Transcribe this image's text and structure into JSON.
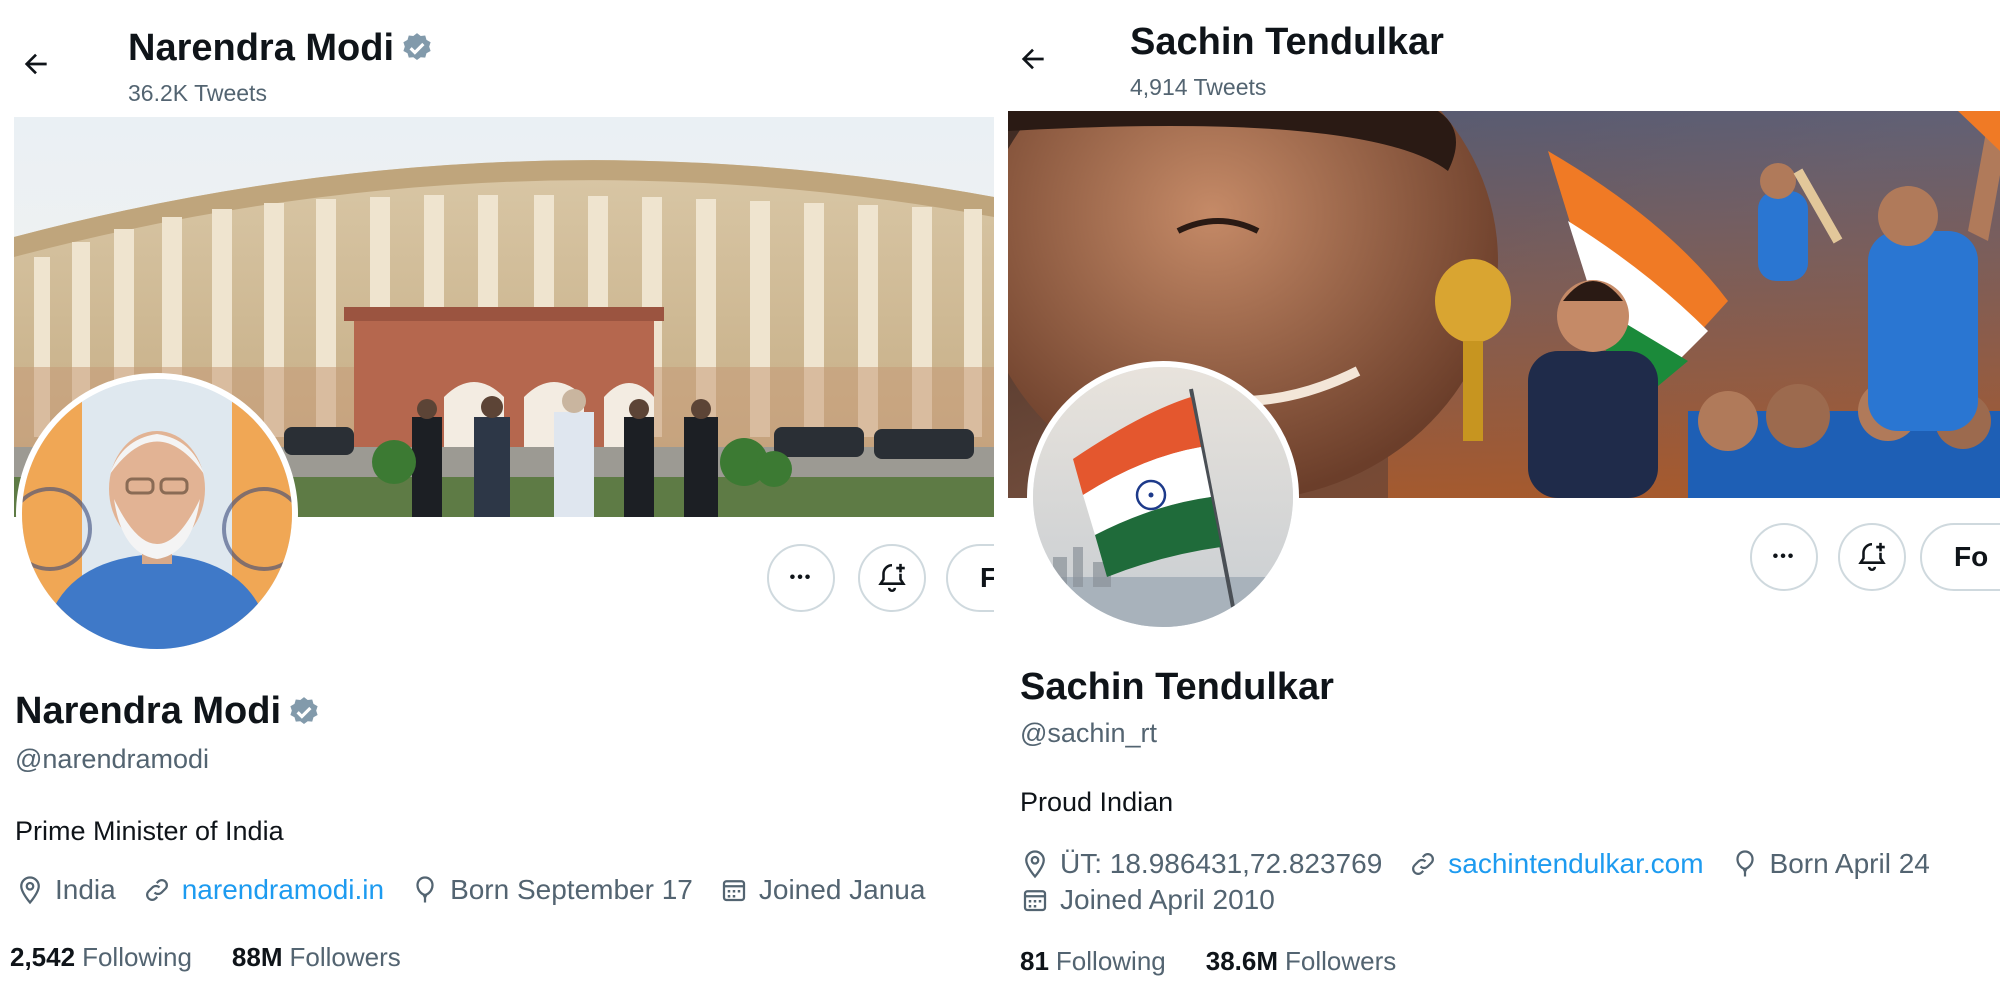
{
  "profiles": [
    {
      "header_name": "Narendra Modi",
      "header_tweets": "36.2K Tweets",
      "name": "Narendra Modi",
      "handle": "@narendramodi",
      "bio": "Prime Minister of India",
      "location": "India",
      "website": "narendramodi.in",
      "born": "Born September 17",
      "joined": "Joined Janua",
      "following_count": "2,542",
      "following_label": "Following",
      "followers_count": "88M",
      "followers_label": "Followers",
      "more_label": "•••",
      "follow_label": "F",
      "verified": true
    },
    {
      "header_name": "Sachin Tendulkar",
      "header_tweets": "4,914 Tweets",
      "name": "Sachin Tendulkar",
      "handle": "@sachin_rt",
      "bio": "Proud Indian",
      "location": "ÜT: 18.986431,72.823769",
      "website": "sachintendulkar.com",
      "born": "Born April 24",
      "joined": "Joined April 2010",
      "following_count": "81",
      "following_label": "Following",
      "followers_count": "38.6M",
      "followers_label": "Followers",
      "more_label": "•••",
      "follow_label": "Fo",
      "verified": false
    }
  ],
  "colors": {
    "link": "#1d9bf0",
    "secondary_text": "#536471",
    "verified_badge": "#829aab",
    "border": "#cfd9de"
  },
  "icons": [
    "back-arrow-icon",
    "verified-badge-icon",
    "more-icon",
    "notification-bell-plus-icon",
    "location-pin-icon",
    "link-icon",
    "birthday-balloon-icon",
    "calendar-icon"
  ]
}
